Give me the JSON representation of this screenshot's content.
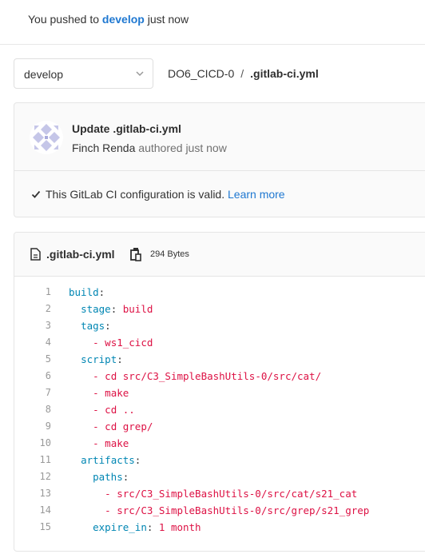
{
  "push_notice": {
    "prefix": "You pushed to ",
    "branch": "develop",
    "suffix": " just now"
  },
  "branch_selector": {
    "value": "develop"
  },
  "breadcrumb": {
    "project": "DO6_CICD-0",
    "separator": "/",
    "file": ".gitlab-ci.yml"
  },
  "commit": {
    "title": "Update .gitlab-ci.yml",
    "author": "Finch Renda",
    "authored": "authored just now",
    "ci_status": "This GitLab CI configuration is valid.",
    "learn_more": "Learn more"
  },
  "file": {
    "name": ".gitlab-ci.yml",
    "size": "294 Bytes",
    "lines": [
      {
        "n": "1",
        "indent": "",
        "key": "build",
        "sep": ":",
        "dash": "",
        "value": ""
      },
      {
        "n": "2",
        "indent": "  ",
        "key": "stage",
        "sep": ":",
        "dash": "",
        "value": " build"
      },
      {
        "n": "3",
        "indent": "  ",
        "key": "tags",
        "sep": ":",
        "dash": "",
        "value": ""
      },
      {
        "n": "4",
        "indent": "    ",
        "key": "",
        "sep": "",
        "dash": "- ",
        "value": "ws1_cicd"
      },
      {
        "n": "5",
        "indent": "  ",
        "key": "script",
        "sep": ":",
        "dash": "",
        "value": ""
      },
      {
        "n": "6",
        "indent": "    ",
        "key": "",
        "sep": "",
        "dash": "- ",
        "value": "cd src/C3_SimpleBashUtils-0/src/cat/"
      },
      {
        "n": "7",
        "indent": "    ",
        "key": "",
        "sep": "",
        "dash": "- ",
        "value": "make"
      },
      {
        "n": "8",
        "indent": "    ",
        "key": "",
        "sep": "",
        "dash": "- ",
        "value": "cd .."
      },
      {
        "n": "9",
        "indent": "    ",
        "key": "",
        "sep": "",
        "dash": "- ",
        "value": "cd grep/"
      },
      {
        "n": "10",
        "indent": "    ",
        "key": "",
        "sep": "",
        "dash": "- ",
        "value": "make"
      },
      {
        "n": "11",
        "indent": "  ",
        "key": "artifacts",
        "sep": ":",
        "dash": "",
        "value": ""
      },
      {
        "n": "12",
        "indent": "    ",
        "key": "paths",
        "sep": ":",
        "dash": "",
        "value": ""
      },
      {
        "n": "13",
        "indent": "      ",
        "key": "",
        "sep": "",
        "dash": "- ",
        "value": "src/C3_SimpleBashUtils-0/src/cat/s21_cat"
      },
      {
        "n": "14",
        "indent": "      ",
        "key": "",
        "sep": "",
        "dash": "- ",
        "value": "src/C3_SimpleBashUtils-0/src/grep/s21_grep"
      },
      {
        "n": "15",
        "indent": "    ",
        "key": "expire_in",
        "sep": ":",
        "dash": "",
        "value": " 1 month"
      }
    ]
  },
  "colors": {
    "link": "#1f78d1",
    "yaml_key": "#0086b3",
    "yaml_value": "#dd1144"
  },
  "icons": {
    "chevron": "chevron-down-icon",
    "check": "check-icon",
    "file": "file-icon",
    "copy": "copy-icon"
  }
}
